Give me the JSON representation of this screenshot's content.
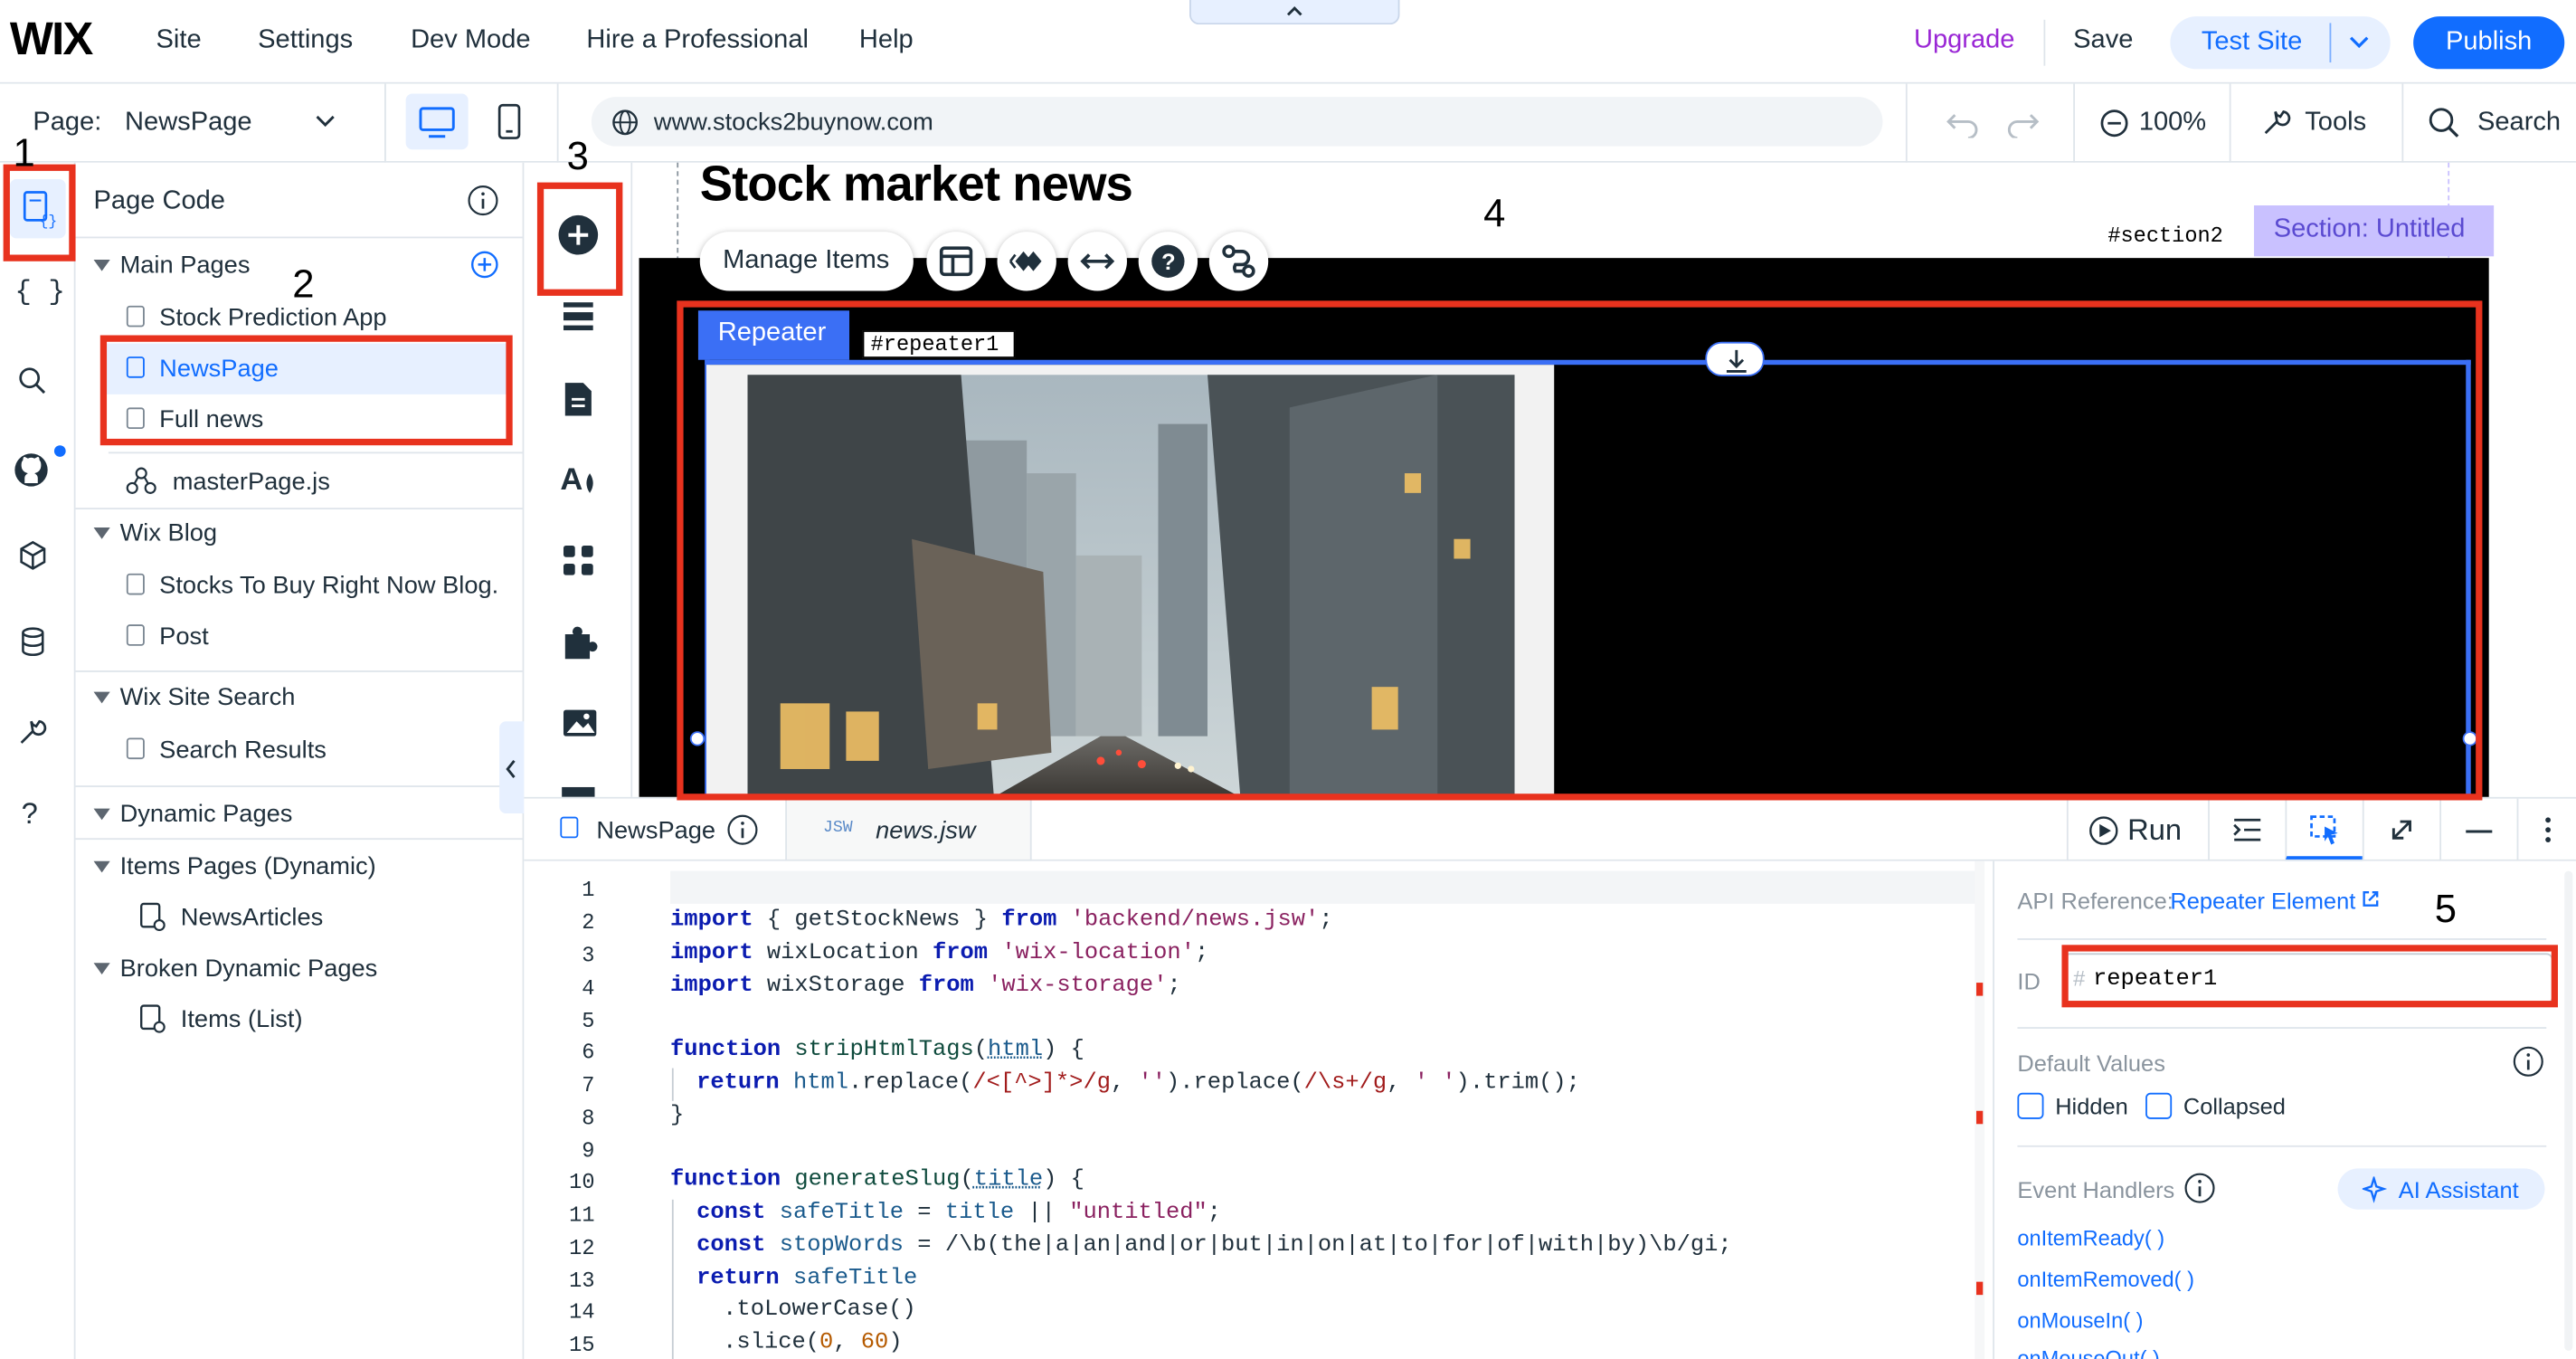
{
  "topbar": {
    "logo": "WIX",
    "menu": [
      "Site",
      "Settings",
      "Dev Mode",
      "Hire a Professional",
      "Help"
    ],
    "upgrade": "Upgrade",
    "save": "Save",
    "test_site": "Test Site",
    "publish": "Publish"
  },
  "bar2": {
    "page_label": "Page:",
    "page_value": "NewsPage",
    "url": "www.stocks2buynow.com",
    "zoom": "100%",
    "tools": "Tools",
    "search": "Search"
  },
  "page_code": {
    "title": "Page Code",
    "groups": {
      "main": "Main Pages",
      "blog": "Wix Blog",
      "search": "Wix Site Search",
      "dynamic": "Dynamic Pages"
    },
    "items": {
      "stock_app": "Stock Prediction App",
      "newspage": "NewsPage",
      "full_news": "Full news",
      "master": "masterPage.js",
      "blog_page": "Stocks To Buy Right Now Blog.",
      "post": "Post",
      "search_results": "Search Results",
      "items_pages": "Items Pages (Dynamic)",
      "news_articles": "NewsArticles",
      "broken": "Broken Dynamic Pages",
      "items_list": "Items (List)"
    }
  },
  "canvas": {
    "title": "Stock market news",
    "manage_items": "Manage Items",
    "section_id": "#section2",
    "section_label": "Section: Untitled",
    "repeater_label": "Repeater",
    "repeater_id": "#repeater1"
  },
  "code_panel": {
    "tab1": "NewsPage",
    "tab2_badge": "JSW",
    "tab2": "news.jsw",
    "run": "Run"
  },
  "code_lines": [
    {
      "n": "1"
    },
    {
      "n": "2"
    },
    {
      "n": "3"
    },
    {
      "n": "4"
    },
    {
      "n": "5"
    },
    {
      "n": "6"
    },
    {
      "n": "7"
    },
    {
      "n": "8"
    },
    {
      "n": "9"
    },
    {
      "n": "10"
    },
    {
      "n": "11"
    },
    {
      "n": "12"
    },
    {
      "n": "13"
    },
    {
      "n": "14"
    },
    {
      "n": "15"
    }
  ],
  "code_text": {
    "l2": [
      "import",
      " { getStockNews } ",
      "from",
      " ",
      "'backend/news.jsw'",
      ";"
    ],
    "l3": [
      "import",
      " wixLocation ",
      "from",
      " ",
      "'wix-location'",
      ";"
    ],
    "l4": [
      "import",
      " wixStorage ",
      "from",
      " ",
      "'wix-storage'",
      ";"
    ],
    "l6": [
      "function",
      " ",
      "stripHtmlTags",
      "(",
      "html",
      ") {"
    ],
    "l7": [
      "return",
      " ",
      "html",
      ".replace(",
      "/<[^>]*>/g",
      ", ",
      "''",
      ").replace(",
      "/\\s+/g",
      ", ",
      "' '",
      ").trim();"
    ],
    "l8": "}",
    "l10": [
      "function",
      " ",
      "generateSlug",
      "(",
      "title",
      ") {"
    ],
    "l11": [
      "const",
      " ",
      "safeTitle",
      " = ",
      "title",
      " || ",
      "\"untitled\"",
      ";"
    ],
    "l12": [
      "const",
      " ",
      "stopWords",
      " = ",
      "/\\b(the|a|an|and|or|but|in|on|at|to|for|of|with|by)\\b/gi",
      ";"
    ],
    "l13": [
      "return",
      " ",
      "safeTitle"
    ],
    "l14": ".toLowerCase()",
    "l15": [
      ".slice(",
      "0",
      ", ",
      "60",
      ")"
    ]
  },
  "props": {
    "api_ref_label": "API Reference:",
    "api_ref_link": "Repeater Element",
    "id_label": "ID",
    "id_hash": "#",
    "id_value": "repeater1",
    "default_values": "Default Values",
    "hidden": "Hidden",
    "collapsed": "Collapsed",
    "event_handlers": "Event Handlers",
    "ai_assistant": "AI Assistant",
    "handlers": [
      "onItemReady( )",
      "onItemRemoved( )",
      "onMouseIn( )",
      "onMouseOut( )"
    ]
  },
  "annotations": [
    "1",
    "2",
    "3",
    "4",
    "5"
  ],
  "colors": {
    "accent": "#116dff",
    "upgrade": "#9a27d5",
    "annotation_red": "#e8321e",
    "repeater_blue": "#3b6ff5",
    "section_purple": "#c9c1ff"
  }
}
